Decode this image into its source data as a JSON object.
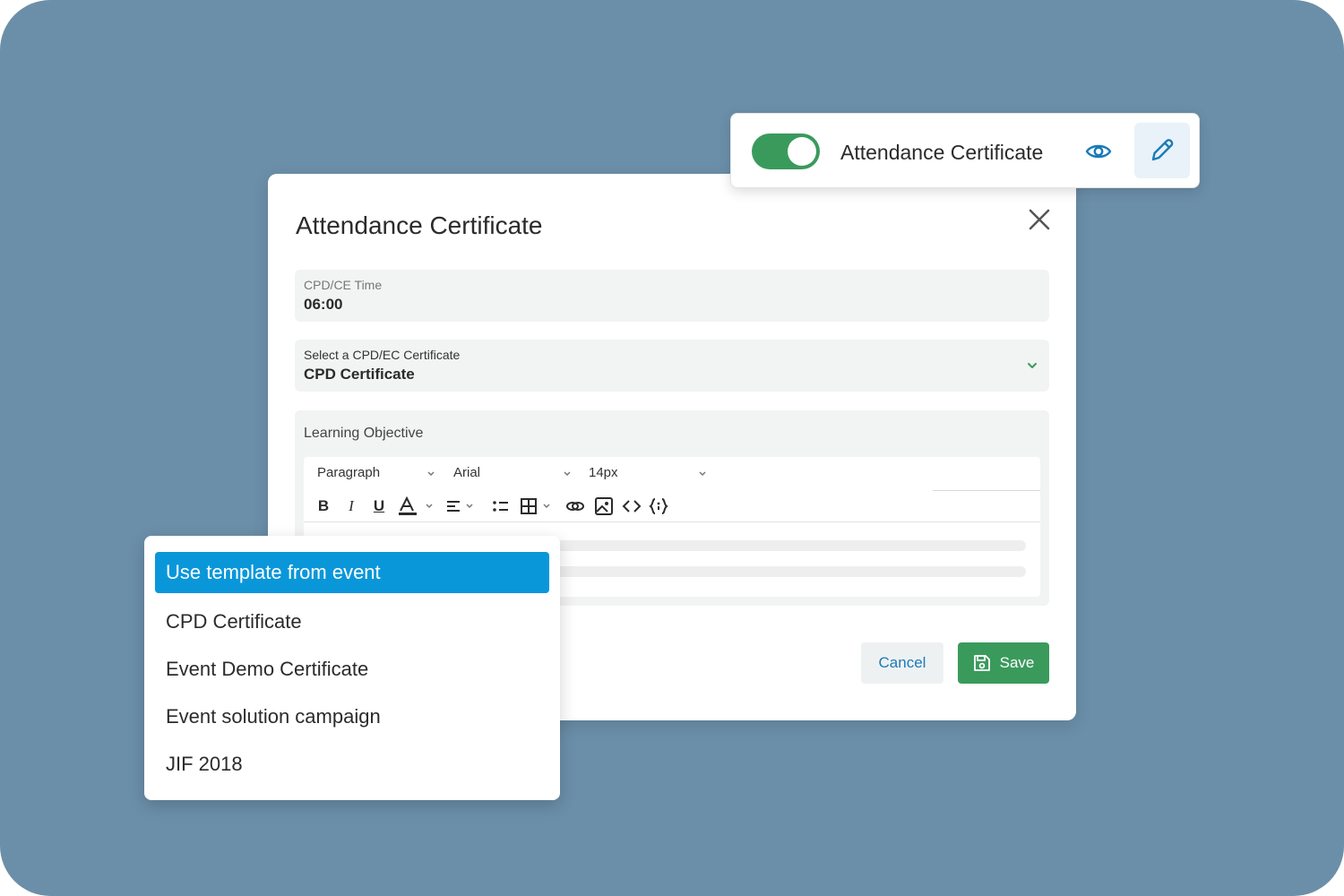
{
  "topcard": {
    "title": "Attendance Certificate",
    "toggle_state": "on"
  },
  "dialog": {
    "title": "Attendance Certificate",
    "cpd_time": {
      "label": "CPD/CE Time",
      "value": "06:00"
    },
    "certificate_select": {
      "label": "Select a CPD/EC Certificate",
      "value": "CPD Certificate"
    },
    "objective": {
      "label": "Learning Objective",
      "editor": {
        "block_format": "Paragraph",
        "font_family": "Arial",
        "font_size": "14px",
        "bold": "B",
        "italic": "I",
        "underline": "U"
      }
    },
    "cancel_label": "Cancel",
    "save_label": "Save"
  },
  "dropdown": {
    "items": [
      {
        "label": "Use template from event",
        "selected": true
      },
      {
        "label": "CPD Certificate"
      },
      {
        "label": "Event Demo Certificate"
      },
      {
        "label": "Event solution campaign"
      },
      {
        "label": "JIF 2018"
      }
    ]
  },
  "colors": {
    "backdrop": "#6b8fa9",
    "accent_green": "#3a9a5c",
    "accent_blue": "#0a97d9",
    "link_blue": "#1a7bb8"
  }
}
